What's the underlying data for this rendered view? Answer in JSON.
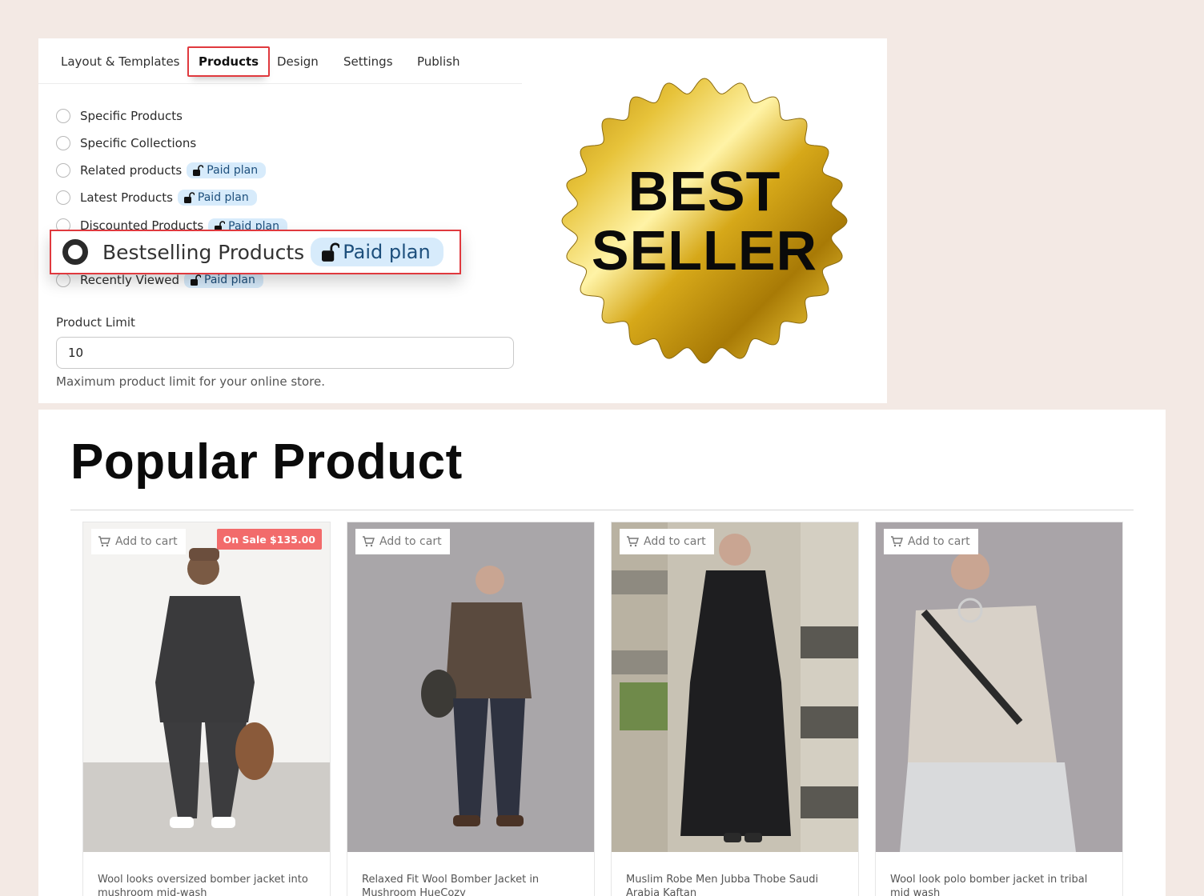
{
  "tabs": [
    "Layout & Templates",
    "Products",
    "Design",
    "Settings",
    "Publish"
  ],
  "active_tab": "Products",
  "options": [
    {
      "label": "Specific Products",
      "badge": ""
    },
    {
      "label": "Specific Collections",
      "badge": ""
    },
    {
      "label": "Related products",
      "badge": "Paid plan"
    },
    {
      "label": "Latest Products",
      "badge": "Paid plan"
    },
    {
      "label": "Discounted Products",
      "badge": "Paid plan"
    },
    {
      "label": "Bestselling Products",
      "badge": "Paid plan",
      "selected": true
    },
    {
      "label": "Recently Viewed",
      "badge": "Paid plan"
    }
  ],
  "product_limit": {
    "label": "Product Limit",
    "value": "10",
    "help": "Maximum product limit for your online store."
  },
  "seal": {
    "line1": "BEST",
    "line2": "SELLER"
  },
  "popular": {
    "title": "Popular Product",
    "add_to_cart": "Add to cart",
    "products": [
      {
        "title": "Wool looks oversized bomber jacket into mushroom mid-wash",
        "sale": "On Sale $135.00"
      },
      {
        "title": "Relaxed Fit Wool Bomber Jacket in Mushroom HueCozy",
        "sale": ""
      },
      {
        "title": "Muslim Robe Men Jubba Thobe Saudi Arabia Kaftan",
        "sale": ""
      },
      {
        "title": "Wool look polo bomber jacket in tribal mid wash",
        "sale": ""
      }
    ]
  },
  "colors": {
    "page_bg": "#f3e9e4",
    "highlight_red": "#e0393e",
    "badge_bg": "#d7ebfb",
    "sale_bg": "#f26b6b",
    "gold": "#d4a514"
  },
  "icons": [
    "lock-icon",
    "cart-icon",
    "best-seller-seal"
  ]
}
